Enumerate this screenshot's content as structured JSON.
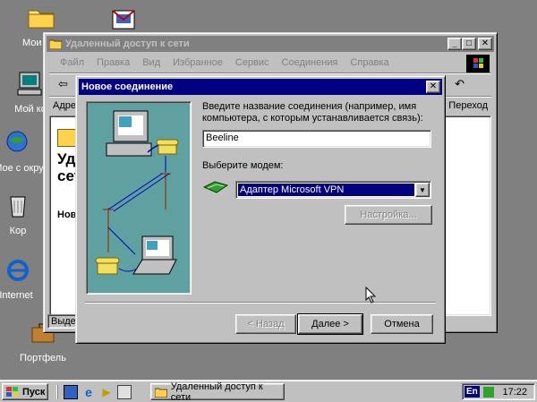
{
  "desktop": {
    "icons": [
      {
        "label": "Мои док",
        "icon": "folder-icon"
      },
      {
        "label": "Мой ко",
        "icon": "computer-icon"
      },
      {
        "label": "Мое с окру",
        "icon": "network-icon"
      },
      {
        "label": "Кор",
        "icon": "recycle-bin-icon"
      },
      {
        "label": "Internet",
        "icon": "internet-explorer-icon"
      },
      {
        "label": "Портфель",
        "icon": "briefcase-icon"
      }
    ],
    "background": "#808080"
  },
  "bg_window": {
    "title": "Удаленный доступ к сети",
    "menu": [
      "Файл",
      "Правка",
      "Вид",
      "Избранное",
      "Сервис",
      "Соединения",
      "Справка"
    ],
    "address_label": "Адре",
    "go_label": "Переход",
    "panel_title_1": "Уд",
    "panel_title_2": "сет",
    "panel_sub": "Нов",
    "status": "Выдел"
  },
  "dialog": {
    "title": "Новое соединение",
    "name_prompt_1": "Введите название соединения (например, имя",
    "name_prompt_2": "компьютера, с которым устанавливается связь):",
    "name_value": "Beeline",
    "modem_label": "Выберите модем:",
    "modem_value": "Адаптер Microsoft VPN",
    "settings_button": "Настройка...",
    "back_button": "< Назад",
    "next_button": "Далее >",
    "cancel_button": "Отмена",
    "accent": "#000080",
    "illustration_bg": "#5fa0a0"
  },
  "taskbar": {
    "start_label": "Пуск",
    "task_label": "Удаленный доступ к сети",
    "lang": "En",
    "clock": "17:22"
  }
}
